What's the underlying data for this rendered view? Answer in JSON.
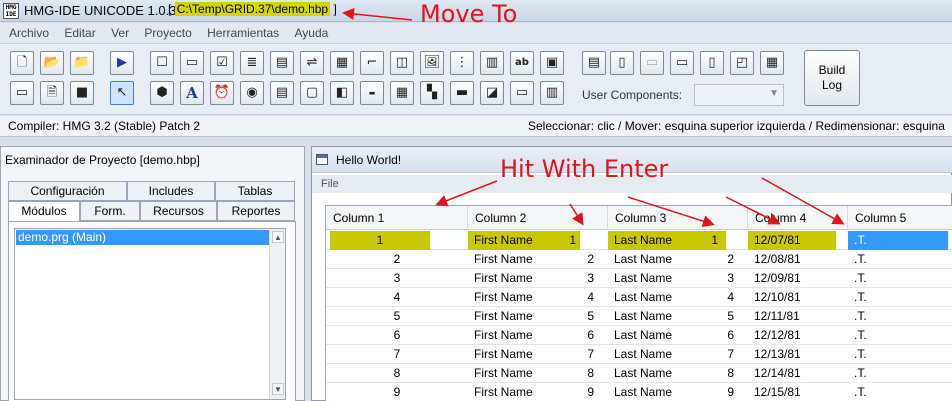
{
  "titlebar": {
    "app_icon_text": "HMG IDE",
    "app_title": "HMG-IDE  UNICODE  1.0.3",
    "path_open": "[",
    "path": "C:\\Temp\\GRID.37\\demo.hbp",
    "path_close": "]"
  },
  "menubar": {
    "items": [
      "Archivo",
      "Editar",
      "Ver",
      "Proyecto",
      "Herramientas",
      "Ayuda"
    ]
  },
  "toolbar": {
    "row1_icons": [
      "new-file",
      "open-folder",
      "open-project",
      "run",
      "frame",
      "button",
      "checkbox",
      "listbox",
      "combobox",
      "spinner",
      "grid",
      "progress",
      "editbox",
      "image",
      "tree",
      "datepicker",
      "label",
      "picture",
      "browse",
      "report",
      "edit",
      "edit-box",
      "timer",
      "player",
      "monthcal"
    ],
    "row2_icons": [
      "window",
      "document",
      "stop",
      "pointer",
      "activex",
      "font",
      "timer-clock",
      "radio",
      "rich-edit",
      "frame-box",
      "ipaddress",
      "hyperlink",
      "grid2",
      "animate",
      "progress-bar",
      "tab",
      "grid3",
      "select-all"
    ],
    "user_components_label": "User Components:",
    "user_components_value": "",
    "build_log_line1": "Build",
    "build_log_line2": "Log"
  },
  "statusbar": {
    "left": "Compiler: HMG 3.2 (Stable) Patch 2",
    "right": "Seleccionar: clic / Mover: esquina superior izquierda / Redimensionar: esquina"
  },
  "explorer": {
    "title": "Examinador de Proyecto [demo.hbp]",
    "tabs_row1": [
      "Configuración",
      "Includes",
      "Tablas"
    ],
    "tabs_row2": [
      "Módulos",
      "Form.",
      "Recursos",
      "Reportes"
    ],
    "selected_tab": "Módulos",
    "files": [
      "demo.prg (Main)"
    ]
  },
  "form_window": {
    "title": "Hello World!",
    "menu_file": "File"
  },
  "grid": {
    "columns": [
      "Column 1",
      "Column 2",
      "Column 3",
      "Column 4",
      "Column 5"
    ],
    "rows": [
      [
        "1",
        "First Name",
        "1",
        "Last Name",
        "1",
        "12/07/81",
        ".T."
      ],
      [
        "2",
        "First Name",
        "2",
        "Last Name",
        "2",
        "12/08/81",
        ".T."
      ],
      [
        "3",
        "First Name",
        "3",
        "Last Name",
        "3",
        "12/09/81",
        ".T."
      ],
      [
        "4",
        "First Name",
        "4",
        "Last Name",
        "4",
        "12/10/81",
        ".T."
      ],
      [
        "5",
        "First Name",
        "5",
        "Last Name",
        "5",
        "12/11/81",
        ".T."
      ],
      [
        "6",
        "First Name",
        "6",
        "Last Name",
        "6",
        "12/12/81",
        ".T."
      ],
      [
        "7",
        "First Name",
        "7",
        "Last Name",
        "7",
        "12/13/81",
        ".T."
      ],
      [
        "8",
        "First Name",
        "8",
        "Last Name",
        "8",
        "12/14/81",
        ".T."
      ],
      [
        "9",
        "First Name",
        "9",
        "Last Name",
        "9",
        "12/15/81",
        ".T."
      ]
    ]
  },
  "annotations": {
    "move_to": "Move To",
    "hit_with_enter": "Hit With Enter"
  },
  "colors": {
    "highlight": "#c8c800",
    "selection": "#3399ff",
    "annotation": "#e0141c"
  }
}
